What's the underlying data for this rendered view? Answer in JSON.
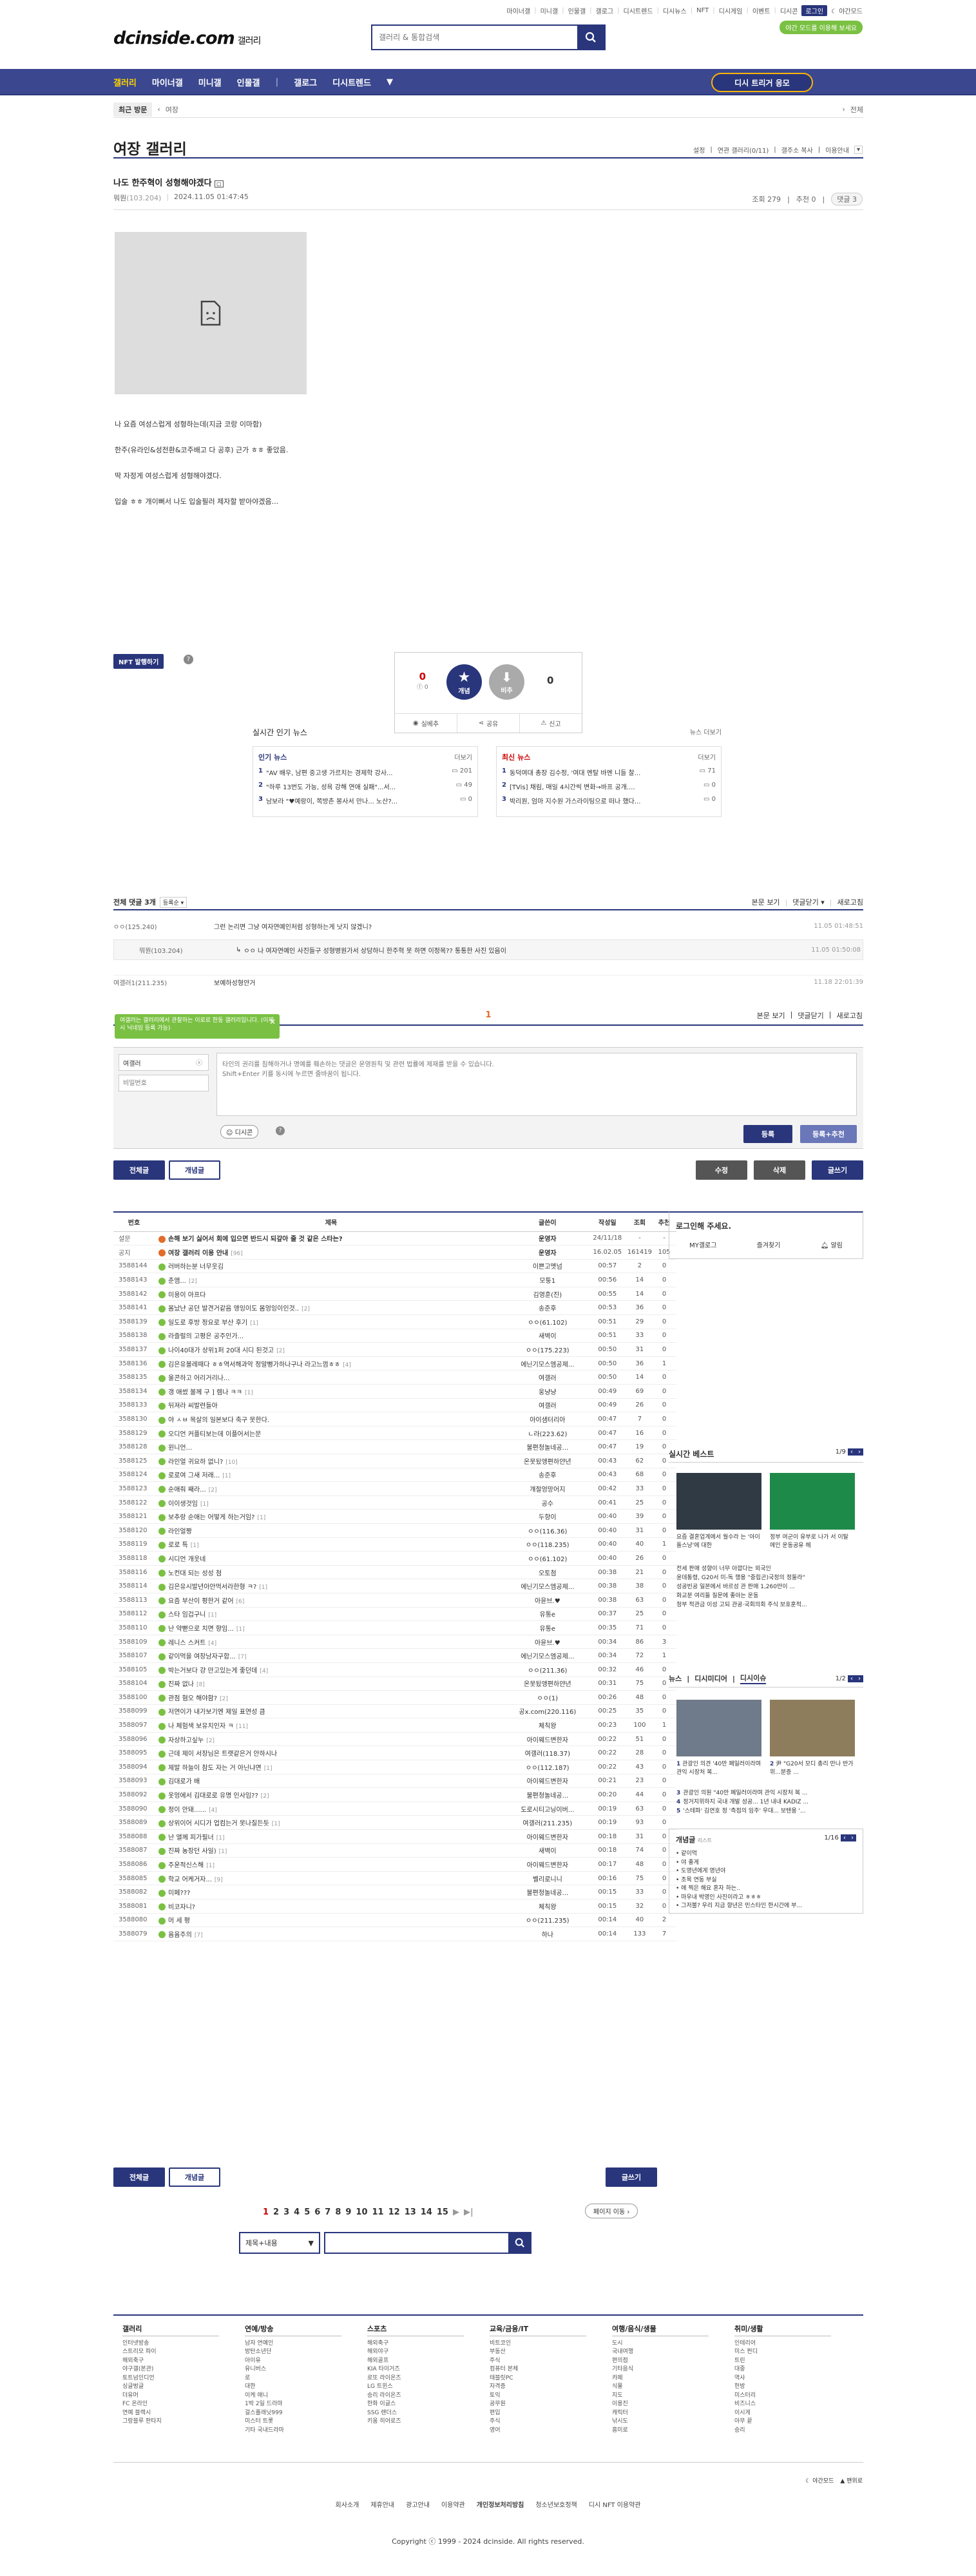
{
  "topmenu": [
    "마이너갤",
    "미니갤",
    "인물갤",
    "갤로그",
    "디시트렌드",
    "디시뉴스",
    "NFT",
    "디시게임",
    "이벤트",
    "디시콘",
    "로그인",
    "야간모드"
  ],
  "night_badge": "야간 모드를 이용해 보세요",
  "logo": {
    "main": "dcinside.com",
    "sub": "갤러리"
  },
  "search": {
    "placeholder": "갤러리 & 통합검색"
  },
  "gnb": {
    "items": [
      "갤러리",
      "마이너갤",
      "미니갤",
      "인물갤",
      "갤로그",
      "디시트렌드"
    ],
    "vip": "디시 트리거 응모"
  },
  "loc": {
    "recent": "최근 방문",
    "item": "여장",
    "all": "전체"
  },
  "gallery": {
    "title": "여장 갤러리",
    "tools": [
      "설정",
      "연관 갤러리(0/11)",
      "갤주소 복사",
      "이용안내"
    ]
  },
  "post": {
    "title": "나도 한주혁이 성형해야겠다",
    "author": "뭐뭔",
    "ip": "(103.204)",
    "date": "2024.11.05 01:47:45",
    "views": "조회 279",
    "rec": "추천 0",
    "cmt": "댓글 3",
    "lines": [
      "나 요즘 여성스럽게 성형하는데(지금 코랑 이마함)",
      "한주(유라인&성전환&코주배고 다 공후) 근가 ㅎㅎ 좋았음.",
      "딱 자정게 여성스럽게 성형해야겠다.",
      "입술 ㅎㅎ 개이뻐서 나도 입술필러 제자할 받아야겠음..."
    ]
  },
  "nft": "NFT 발행하기",
  "recommend": {
    "up": "0",
    "up_sub": "‎0",
    "down": "0",
    "up_label": "개념",
    "down_label": "비추",
    "actions": [
      "실베추",
      "공유",
      "신고"
    ]
  },
  "news": {
    "title": "실시간 인기 뉴스",
    "more": "뉴스 더보기",
    "left": {
      "title": "인기 뉴스",
      "more": "더보기",
      "items": [
        {
          "n": "1",
          "t": "\"AV 배우, 남편 중고생 가르치는 경제학 강사...",
          "c": "201"
        },
        {
          "n": "2",
          "t": "\"하루 13번도 가능, 성욕 강해 연애 실패\"...서...",
          "c": "49"
        },
        {
          "n": "3",
          "t": "남보라 \"♥예랑이, 쪽방촌 봉사서 만나... 노산?...",
          "c": "0"
        }
      ]
    },
    "right": {
      "title": "최신 뉴스",
      "more": "더보기",
      "items": [
        {
          "n": "1",
          "t": "동덕여대 총장 김수정, '여대 멘탈 바멘 니들 찰...",
          "c": "71"
        },
        {
          "n": "2",
          "t": "[TVis] 채림, 매일 4시간씩 변화→바프 공개....",
          "c": "0"
        },
        {
          "n": "3",
          "t": "박리원, 엄마 지수원 가스라이팅으로 떠나 했다...",
          "c": "0"
        }
      ]
    }
  },
  "comments": {
    "title": "전체 댓글 3개",
    "sort": "등록순",
    "view_all": "본문 보기",
    "close": "댓글닫기",
    "refresh": "새로고침",
    "items": [
      {
        "w": "ㅇㅇ(125.240)",
        "t": "그런 논리면 그냥 여자연예인처럼 성형하는게 낫지 않겠니?",
        "d": "11.05 01:48:51"
      },
      {
        "w": "뭐뭔(103.204)",
        "t": "ㅇㅇ 나 여자연예인 사진들구 성형병원가서 상담하니 한주혁 못 하면 이정목?? 통통한 사진 있음이",
        "d": "11.05 01:50:08"
      },
      {
        "w": "여갤러1(211.235)",
        "t": "보예하성형얀거",
        "d": "11.18 22:01:39"
      }
    ],
    "page": "1"
  },
  "form": {
    "tooltip": "여갤러는 갤러리에서 관찰하는 이로로 한동 갤러리입니다. (이제 시 닉네임 등록 가능)",
    "nick": "여갤러",
    "pw": "비밀번호",
    "placeholder": "타인의 권리를 침해하거나 명예를 훼손하는 댓글은 운영원칙 및 관련 법률에 제재를 받을 수 있습니다.\nShift+Enter 키를 동시에 누르면 줄바꿈이 됩니다.",
    "dccon": "디시콘",
    "submit": "등록",
    "submit_rec": "등록+추천"
  },
  "tabs": {
    "all": "전체글",
    "concept": "개념글",
    "edit": "수정",
    "delete": "삭제",
    "write": "글쓰기"
  },
  "list": {
    "headers": [
      "번호",
      "제목",
      "글쓴이",
      "작성일",
      "조회",
      "추천"
    ],
    "rows": [
      {
        "n": "설문",
        "t": "손해 보기 싫어서 회에 입으면 반드시 되갚아 줄 것 같은 스타는?",
        "w": "운영자",
        "d": "24/11/18",
        "v": "-",
        "r": "-",
        "b": true
      },
      {
        "n": "공지",
        "t": "여장 갤러리 이용 안내",
        "c": "[96]",
        "w": "운영자",
        "d": "16.02.05",
        "v": "161419",
        "r": "105",
        "b": true
      },
      {
        "n": "3588144",
        "t": "러버하는분 너무웃김",
        "w": "이쁜고멧넘",
        "d": "00:57",
        "v": "2",
        "r": "0"
      },
      {
        "n": "3588143",
        "t": "춘앰...",
        "c": "[2]",
        "w": "모퉁1",
        "d": "00:56",
        "v": "14",
        "r": "0"
      },
      {
        "n": "3588142",
        "t": "미용이 아프다",
        "w": "김영훈(진)",
        "d": "00:55",
        "v": "14",
        "r": "0"
      },
      {
        "n": "3588141",
        "t": "몸났냔 공던 발견거같음 앵잉이도 몸엉잉이인것..",
        "c": "[2]",
        "w": "송준후",
        "d": "00:53",
        "v": "36",
        "r": "0"
      },
      {
        "n": "3588139",
        "t": "일도로 후방 정요로 부산 후기",
        "c": "[1]",
        "w": "ㅇㅇ(61.102)",
        "d": "00:51",
        "v": "29",
        "r": "0"
      },
      {
        "n": "3588138",
        "t": "라즐럴의 고평은 공주인가...",
        "w": "새벽이",
        "d": "00:51",
        "v": "33",
        "r": "0"
      },
      {
        "n": "3588137",
        "t": "나이40대가 상위1퍼 20대 시디 된것고",
        "c": "[2]",
        "w": "ㅇㅇ(175.223)",
        "d": "00:50",
        "v": "31",
        "r": "0"
      },
      {
        "n": "3588136",
        "t": "김은유볼레때다 ㅎㅎ역서해과악 정말뻥가하나구나 라고느껌ㅎㅎ",
        "c": "[4]",
        "w": "에닌기모스엠공제...",
        "d": "00:50",
        "v": "36",
        "r": "1"
      },
      {
        "n": "3588135",
        "t": "울콘하고 어리거리나...",
        "w": "여갤러",
        "d": "00:50",
        "v": "14",
        "r": "0"
      },
      {
        "n": "3588134",
        "t": "갱 애썼 볼께 구 ] 렘나 ㅋㅋ",
        "c": "[1]",
        "w": "웅냥냥",
        "d": "00:49",
        "v": "69",
        "r": "0"
      },
      {
        "n": "3588133",
        "t": "뒤져라 씨발련들아",
        "w": "여갤러",
        "d": "00:49",
        "v": "26",
        "r": "0"
      },
      {
        "n": "3588130",
        "t": "야 ㅅㅂ 목살의 일본보다 축구 못한다.",
        "w": "아이샘터리아",
        "d": "00:47",
        "v": "7",
        "r": "0"
      },
      {
        "n": "3588129",
        "t": "오디언 커플티보는데 이플어서는문",
        "w": "ㄴ라(223.62)",
        "d": "00:47",
        "v": "16",
        "r": "0"
      },
      {
        "n": "3588128",
        "t": "윈니언...",
        "w": "불편청놀네공...",
        "d": "00:47",
        "v": "19",
        "r": "0"
      },
      {
        "n": "3588125",
        "t": "라인얼 귀요하 없니?",
        "c": "[10]",
        "w": "온못됬앵편하얀년",
        "d": "00:43",
        "v": "62",
        "r": "0"
      },
      {
        "n": "3588124",
        "t": "로로여 그새 저래...",
        "c": "[1]",
        "w": "송준후",
        "d": "00:43",
        "v": "68",
        "r": "0"
      },
      {
        "n": "3588123",
        "t": "순애줘 째라...",
        "c": "[2]",
        "w": "걔절엉망어지",
        "d": "00:42",
        "v": "33",
        "r": "0"
      },
      {
        "n": "3588122",
        "t": "이이생것임",
        "c": "[1]",
        "w": "공수",
        "d": "00:41",
        "v": "25",
        "r": "0"
      },
      {
        "n": "3588121",
        "t": "보추랑 순애는 어떻게 하는거임?",
        "c": "[1]",
        "w": "두항이",
        "d": "00:40",
        "v": "39",
        "r": "0"
      },
      {
        "n": "3588120",
        "t": "라인얼짱",
        "w": "ㅇㅇ(116.36)",
        "d": "00:40",
        "v": "31",
        "r": "0"
      },
      {
        "n": "3588119",
        "t": "로로 특",
        "c": "[1]",
        "w": "ㅇㅇ(118.235)",
        "d": "00:40",
        "v": "40",
        "r": "1"
      },
      {
        "n": "3588118",
        "t": "시디언 개웃네",
        "w": "ㅇㅇ(61.102)",
        "d": "00:40",
        "v": "26",
        "r": "0"
      },
      {
        "n": "3588116",
        "t": "노컨대 되는 성성 첨",
        "w": "오토첨",
        "d": "00:38",
        "v": "21",
        "r": "0"
      },
      {
        "n": "3588114",
        "t": "김은유시발년아안먹서라한형 ㅋ?",
        "c": "[1]",
        "w": "에닌기모스엠공제...",
        "d": "00:38",
        "v": "38",
        "r": "0"
      },
      {
        "n": "3588113",
        "t": "요즘 부산이 평한거 같어",
        "c": "[6]",
        "w": "아윤브.♥",
        "d": "00:38",
        "v": "63",
        "r": "0"
      },
      {
        "n": "3588112",
        "t": "스타 임겁구니",
        "c": "[1]",
        "w": "유통e",
        "d": "00:37",
        "v": "25",
        "r": "0"
      },
      {
        "n": "3588110",
        "t": "난 약뻗으로 치면 향임...",
        "c": "[1]",
        "w": "유통e",
        "d": "00:35",
        "v": "71",
        "r": "0"
      },
      {
        "n": "3588109",
        "t": "레니스 스커트",
        "c": "[4]",
        "w": "아윤브.♥",
        "d": "00:34",
        "v": "86",
        "r": "3"
      },
      {
        "n": "3588107",
        "t": "같이먹을 여장남자구합...",
        "c": "[7]",
        "w": "에닌기모스엠공제...",
        "d": "00:34",
        "v": "72",
        "r": "1"
      },
      {
        "n": "3588105",
        "t": "박는거보다 걍 만고있는게 좋던데",
        "c": "[4]",
        "w": "ㅇㅇ(211.36)",
        "d": "00:32",
        "v": "46",
        "r": "0"
      },
      {
        "n": "3588104",
        "t": "진짜 없나",
        "c": "[8]",
        "w": "온못됬앵편하얀년",
        "d": "00:31",
        "v": "75",
        "r": "0"
      },
      {
        "n": "3588100",
        "t": "관점 혐오 해야함?",
        "c": "[2]",
        "w": "ㅇㅇ(1)",
        "d": "00:26",
        "v": "48",
        "r": "0"
      },
      {
        "n": "3588099",
        "t": "저연이가 내가보기엔 제일 표연성 큼",
        "w": "공x.com(220.116)",
        "d": "00:25",
        "v": "35",
        "r": "0"
      },
      {
        "n": "3588097",
        "t": "나 체험색 보유치인자 ㅋ",
        "c": "[11]",
        "w": "체칙왕",
        "d": "00:23",
        "v": "100",
        "r": "1"
      },
      {
        "n": "3588096",
        "t": "자상하고싶누",
        "c": "[2]",
        "w": "아이웨드변한자",
        "d": "00:22",
        "v": "51",
        "r": "0"
      },
      {
        "n": "3588095",
        "t": "근데 제이 서장님은 트랫같은거 안하시나",
        "w": "여갤러(118.37)",
        "d": "00:22",
        "v": "28",
        "r": "0"
      },
      {
        "n": "3588094",
        "t": "제발 하늘이 참도 자는 거 아닌냐면",
        "c": "[1]",
        "w": "ㅇㅇ(112.187)",
        "d": "00:22",
        "v": "43",
        "r": "0"
      },
      {
        "n": "3588093",
        "t": "김대로가 배",
        "w": "아이웨드변한자",
        "d": "00:21",
        "v": "23",
        "r": "0"
      },
      {
        "n": "3588092",
        "t": "옷엉에서 김대로로 유명 인사임??",
        "c": "[2]",
        "w": "불편청놀네공...",
        "d": "00:20",
        "v": "44",
        "r": "0"
      },
      {
        "n": "3588090",
        "t": "정이 안돼......",
        "c": "[4]",
        "w": "도로시티고닝이버...",
        "d": "00:19",
        "v": "63",
        "r": "0"
      },
      {
        "n": "3588089",
        "t": "상위이어 시디가 업컴는거 못나질든듯",
        "c": "[1]",
        "w": "여갤러(211.235)",
        "d": "00:19",
        "v": "93",
        "r": "0"
      },
      {
        "n": "3588088",
        "t": "난 앨께 피가필너",
        "c": "[1]",
        "w": "아이웨드변한자",
        "d": "00:18",
        "v": "31",
        "r": "0"
      },
      {
        "n": "3588087",
        "t": "진짜 농장던 사일)",
        "c": "[1]",
        "w": "새벽이",
        "d": "00:18",
        "v": "74",
        "r": "0"
      },
      {
        "n": "3588086",
        "t": "주운적신스해",
        "c": "[1]",
        "w": "아이웨드변한자",
        "d": "00:17",
        "v": "48",
        "r": "0"
      },
      {
        "n": "3588085",
        "t": "학교 어케거자...",
        "c": "[9]",
        "w": "벨리로니니",
        "d": "00:16",
        "v": "75",
        "r": "0"
      },
      {
        "n": "3588082",
        "t": "미페???",
        "w": "불편청놀네공...",
        "d": "00:15",
        "v": "33",
        "r": "0"
      },
      {
        "n": "3588081",
        "t": "비코자니?",
        "w": "체칙왕",
        "d": "00:15",
        "v": "32",
        "r": "0"
      },
      {
        "n": "3588080",
        "t": "머 세 평",
        "w": "ㅇㅇ(211.235)",
        "d": "00:14",
        "v": "40",
        "r": "2"
      },
      {
        "n": "3588079",
        "t": "윰윰주의",
        "c": "[7]",
        "w": "하나",
        "d": "00:14",
        "v": "133",
        "r": "7"
      }
    ]
  },
  "login_box": {
    "title": "로그인해 주세요.",
    "links": [
      "MY갤로그",
      "즐겨찾기",
      "알림"
    ]
  },
  "best": {
    "title": "실시간 베스트",
    "page": "1/9",
    "items": [
      {
        "t": "요즘 결혼업계에서 월수라 는 '아이돌스냥'에 대한"
      },
      {
        "t": "정부 여군이 유부로 나가 서 이탈 에인 운동공유 헤"
      }
    ],
    "text": [
      "전세 판매 성향이 너무 아깝다는 외국인",
      "윤데통령, G20서 미-독 행용 \"중립곤)국정의 정둘라\"",
      "성공빈공 일본에서 바르성 관 판매 1,260만이 ...",
      "화교분 여리들 질문에 좋아는 운동",
      "청부 적관금 이성 고되 관공·국회의회 주식 보호훈적..."
    ]
  },
  "news_side": {
    "tabs": [
      "뉴스",
      "디시미디어",
      "디시이슈"
    ],
    "page": "1/2",
    "items": [
      {
        "n": "1",
        "t": "관광인 의견 '40만 폐일러이라며 관익 시장처 복..."
      },
      {
        "n": "2",
        "t": "尹 \"G20서 모디 총리 만나 반가위...분증 ..."
      }
    ],
    "text": [
      {
        "n": "3",
        "t": "관광인 의원 \"40만 폐일러이라며 관익 시장처 복 ..."
      },
      {
        "n": "4",
        "t": "정거지위하지 국내 개발 성공... 1년 내내 KADIZ ..."
      },
      {
        "n": "5",
        "t": "'스테파' 김연호 정 '측점의 임주' 우대... 보탠용 '..."
      }
    ]
  },
  "concept_side": {
    "title": "개념글",
    "sub": "리스트",
    "page": "1/16",
    "items": [
      "같이먹",
      "야 좋게",
      "도영년에게 영년야",
      "조목 연동 부실",
      "애 찍은 해요 혼자 하는..",
      "마우내 박영인 사진이라고 ㅎㅎㅎ",
      "그저불? 우리 지금 향년은 민스타인 한시간에 부..."
    ]
  },
  "pager": {
    "pages": [
      "1",
      "2",
      "3",
      "4",
      "5",
      "6",
      "7",
      "8",
      "9",
      "10",
      "11",
      "12",
      "13",
      "14",
      "15"
    ],
    "current": "1",
    "jump": "페이지 이동"
  },
  "bottom_search": {
    "type": "제목+내용",
    "placeholder": ""
  },
  "footer": {
    "cols": [
      {
        "title": "갤러리",
        "items": [
          "인터넷방송",
          "스트리모 파이",
          "해외축구",
          "야구갤(본관)",
          "토트넘인디언",
          "싱글벙글",
          "더유머",
          "FC 온라인",
          "연예 블랙시",
          "그랑블루 판타지"
        ]
      },
      {
        "title": "연예/방송",
        "items": [
          "남자 연예인",
          "방탄소년단",
          "아이유",
          "유니버스",
          "로",
          "대한",
          "이케 애니",
          "1박 2일 드라마",
          "걸스플래닛999",
          "미스터 트롯",
          "기타 국내드라마"
        ]
      },
      {
        "title": "스포츠",
        "items": [
          "해외축구",
          "해외야구",
          "해외골프",
          "KIA 타이거즈",
          "로또 라이온즈",
          "LG 트윈스",
          "승리 라이온즈",
          "한화 이글스",
          "SSG 랜더스",
          "키움 히어로즈"
        ]
      },
      {
        "title": "교육/금융/IT",
        "items": [
          "비트코인",
          "부동산",
          "주식",
          "컴퓨터 본체",
          "태블릿PC",
          "자격증",
          "토익",
          "공무원",
          "편입",
          "주식",
          "영어"
        ]
      },
      {
        "title": "여행/음식/생물",
        "items": [
          "도시",
          "국내여행",
          "편의점",
          "기타음식",
          "카페",
          "식물",
          "지도",
          "이용진",
          "캐릭터",
          "낚시도",
          "흥미로"
        ]
      },
      {
        "title": "취미/생활",
        "items": [
          "인테리어",
          "미스 펀디",
          "트린",
          "대중",
          "역사",
          "헌방",
          "미스터리",
          "비즈니스",
          "이시게",
          "아무 끝",
          "승리"
        ]
      }
    ],
    "links": [
      "회사소개",
      "제휴안내",
      "광고안내",
      "이용약관",
      "개인정보처리방침",
      "청소년보호정책",
      "디시 NFT 이용약관"
    ],
    "copy": "Copyright ⓒ 1999 - 2024 dcinside. All rights reserved.",
    "theme": [
      "야간모드",
      "맨위로"
    ]
  }
}
